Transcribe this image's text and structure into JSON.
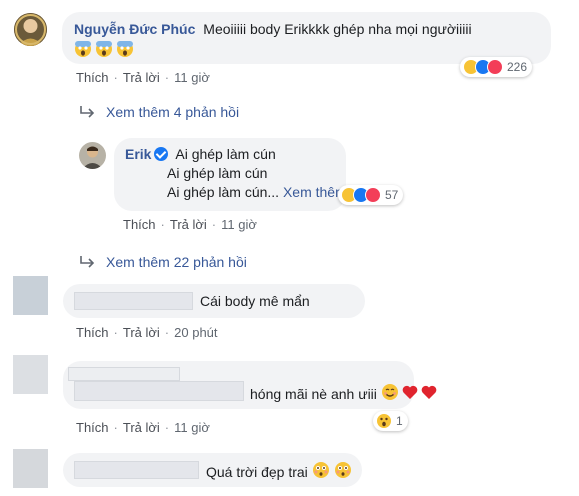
{
  "comment1": {
    "author": "Nguyễn Đức Phúc",
    "text": "Meoiiiii body Erikkkk ghép nha mọi ngườiiiii",
    "emoji_row": [
      "screaming-face-emoji",
      "screaming-face-emoji",
      "screaming-face-emoji"
    ],
    "actions": {
      "like": "Thích",
      "reply": "Trả lời",
      "time": "11 giờ"
    },
    "reaction_count": "226",
    "reaction_icons": [
      "haha-icon",
      "like-icon",
      "love-icon"
    ]
  },
  "more_replies_1": "Xem thêm 4 phản hồi",
  "reply1": {
    "author": "Erik",
    "line1": "Ai ghép làm cún",
    "line2": "Ai ghép làm cún",
    "line3": "Ai ghép làm cún...",
    "see_more": "Xem thêm",
    "actions": {
      "like": "Thích",
      "reply": "Trả lời",
      "time": "11 giờ"
    },
    "reaction_count": "57",
    "reaction_icons": [
      "haha-icon",
      "like-icon",
      "love-icon"
    ]
  },
  "more_replies_2": "Xem thêm 22 phản hồi",
  "comment2": {
    "text": "Cái body mê mẩn",
    "actions": {
      "like": "Thích",
      "reply": "Trả lời",
      "time": "20 phút"
    }
  },
  "comment3": {
    "text": "hóng mãi nè anh ưiii",
    "actions": {
      "like": "Thích",
      "reply": "Trả lời",
      "time": "11 giờ"
    },
    "reaction_count": "1",
    "reaction_icons": [
      "wow-icon"
    ]
  },
  "comment4": {
    "text": "Quá trời đẹp trai"
  },
  "colors": {
    "link_blue": "#385898",
    "bubble_bg": "#f2f3f5",
    "meta_gray": "#606770",
    "love_red": "#f33e58",
    "like_blue": "#1877f2",
    "emoji_yellow": "#f7c335"
  }
}
